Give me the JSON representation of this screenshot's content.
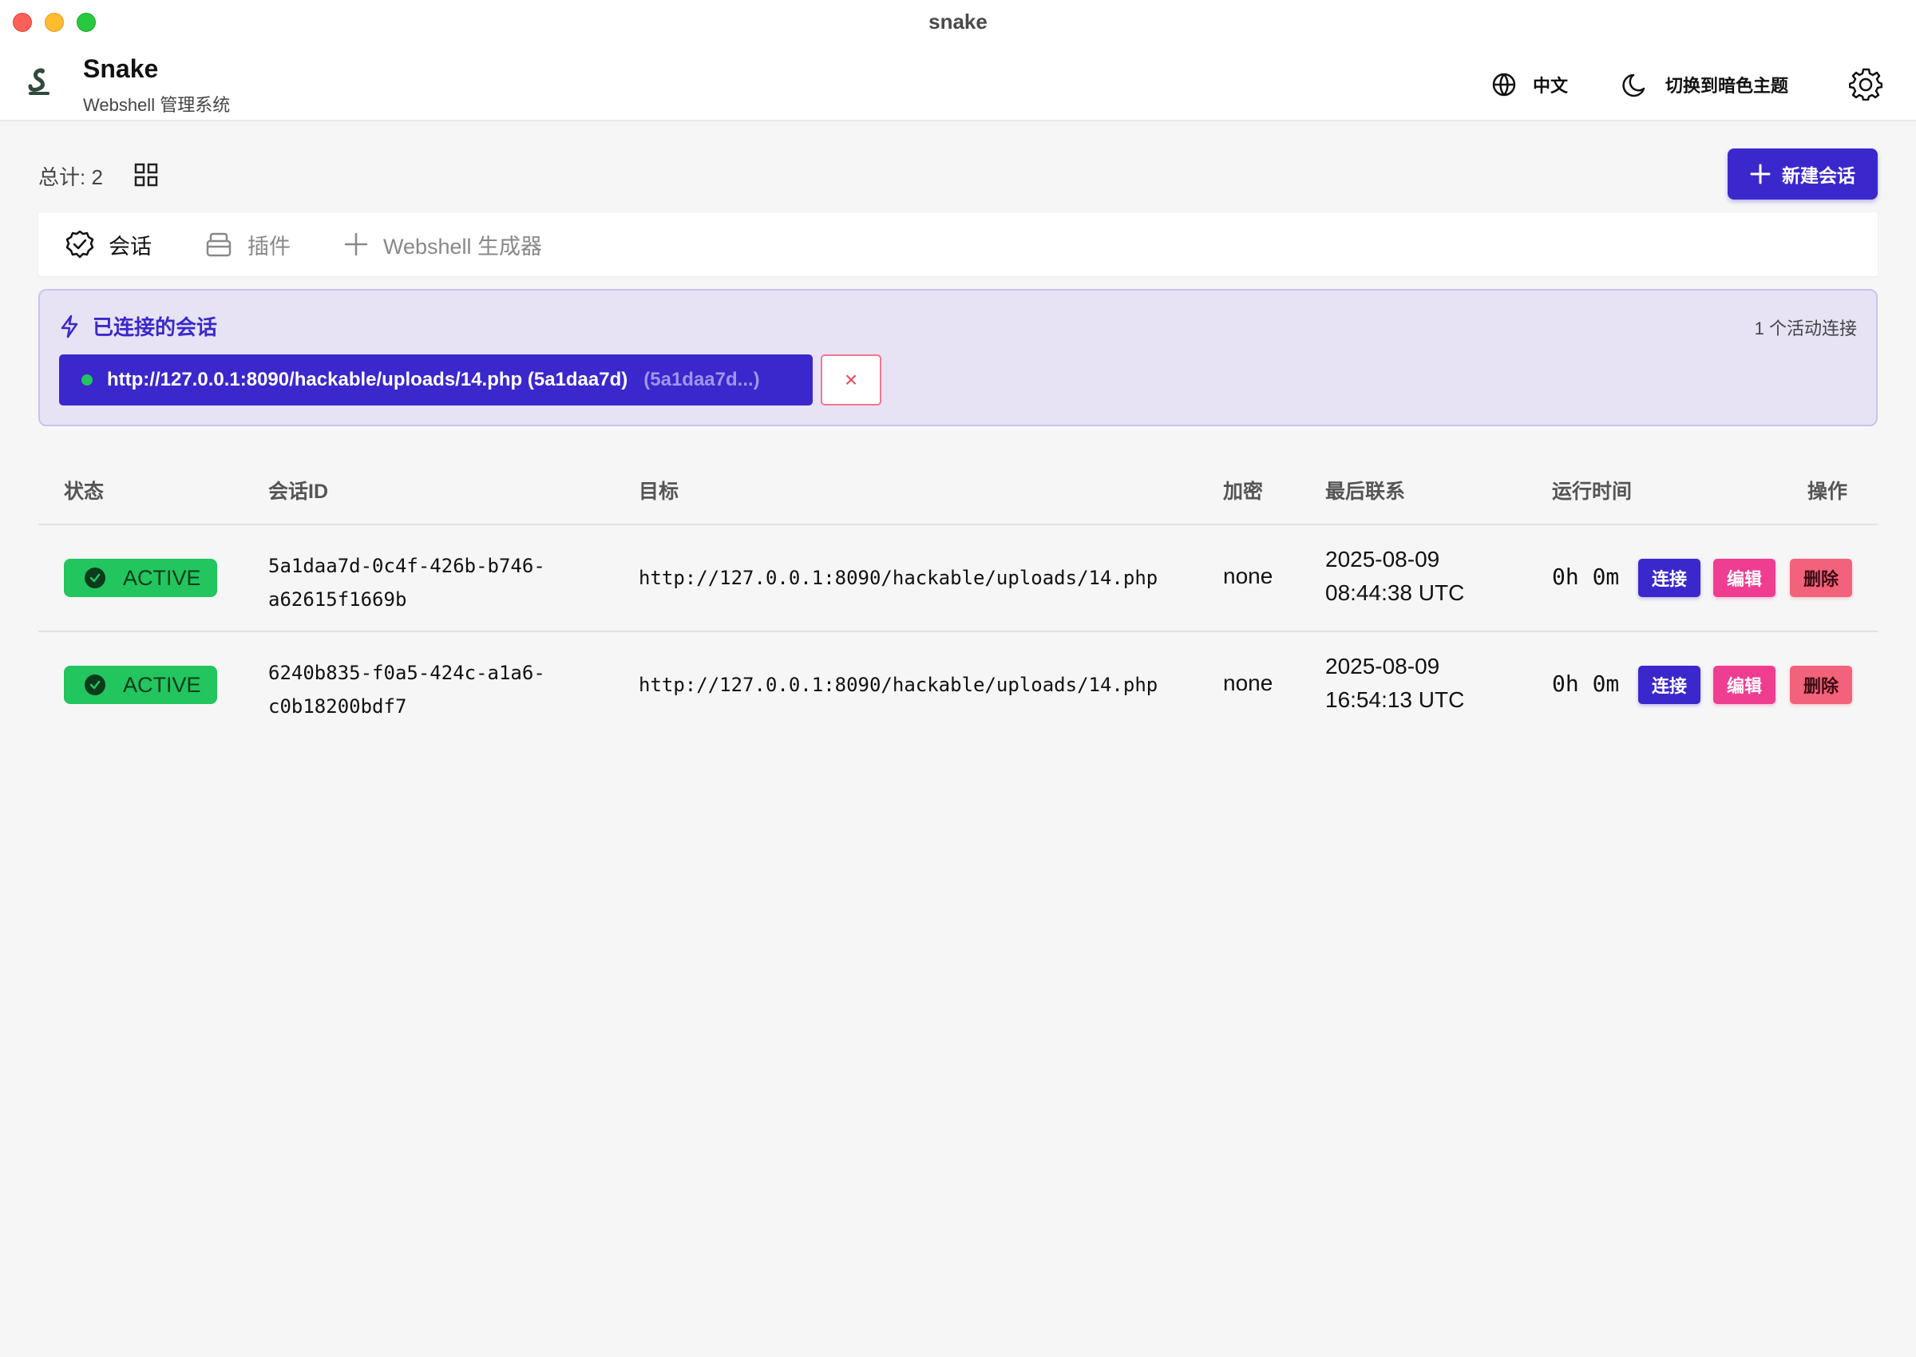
{
  "window": {
    "title": "snake"
  },
  "header": {
    "brand": "Snake",
    "subtitle": "Webshell 管理系统",
    "language": "中文",
    "theme_toggle": "切换到暗色主题"
  },
  "toolbar": {
    "total_label": "总计: 2",
    "new_session": "新建会话"
  },
  "tabs": [
    {
      "label": "会话",
      "icon": "check-circle-icon",
      "active": true
    },
    {
      "label": "插件",
      "icon": "archive-icon",
      "active": false
    },
    {
      "label": "Webshell 生成器",
      "icon": "plus-icon",
      "active": false
    }
  ],
  "connected": {
    "title": "已连接的会话",
    "count": "1 个活动连接",
    "chip_label": "http://127.0.0.1:8090/hackable/uploads/14.php (5a1daa7d)",
    "chip_short": "(5a1daa7d...)",
    "close": "×"
  },
  "table": {
    "headers": {
      "status": "状态",
      "session_id": "会话ID",
      "target": "目标",
      "encryption": "加密",
      "last_contact": "最后联系",
      "uptime": "运行时间",
      "actions": "操作"
    },
    "rows": [
      {
        "status": "ACTIVE",
        "id_line1": "5a1daa7d-0c4f-426b-b746-",
        "id_line2": "a62615f1669b",
        "target": "http://127.0.0.1:8090/hackable/uploads/14.php",
        "encryption": "none",
        "last_line1": "2025-08-09",
        "last_line2": "08:44:38 UTC",
        "uptime": "0h 0m",
        "connect": "连接",
        "edit": "编辑",
        "delete": "删除"
      },
      {
        "status": "ACTIVE",
        "id_line1": "6240b835-f0a5-424c-a1a6-",
        "id_line2": "c0b18200bdf7",
        "target": "http://127.0.0.1:8090/hackable/uploads/14.php",
        "encryption": "none",
        "last_line1": "2025-08-09",
        "last_line2": "16:54:13 UTC",
        "uptime": "0h 0m",
        "connect": "连接",
        "edit": "编辑",
        "delete": "删除"
      }
    ]
  },
  "colors": {
    "accent": "#3b28cc",
    "active_green": "#22c55e",
    "edit_pink": "#ef3d91",
    "delete_red": "#f2627a"
  }
}
